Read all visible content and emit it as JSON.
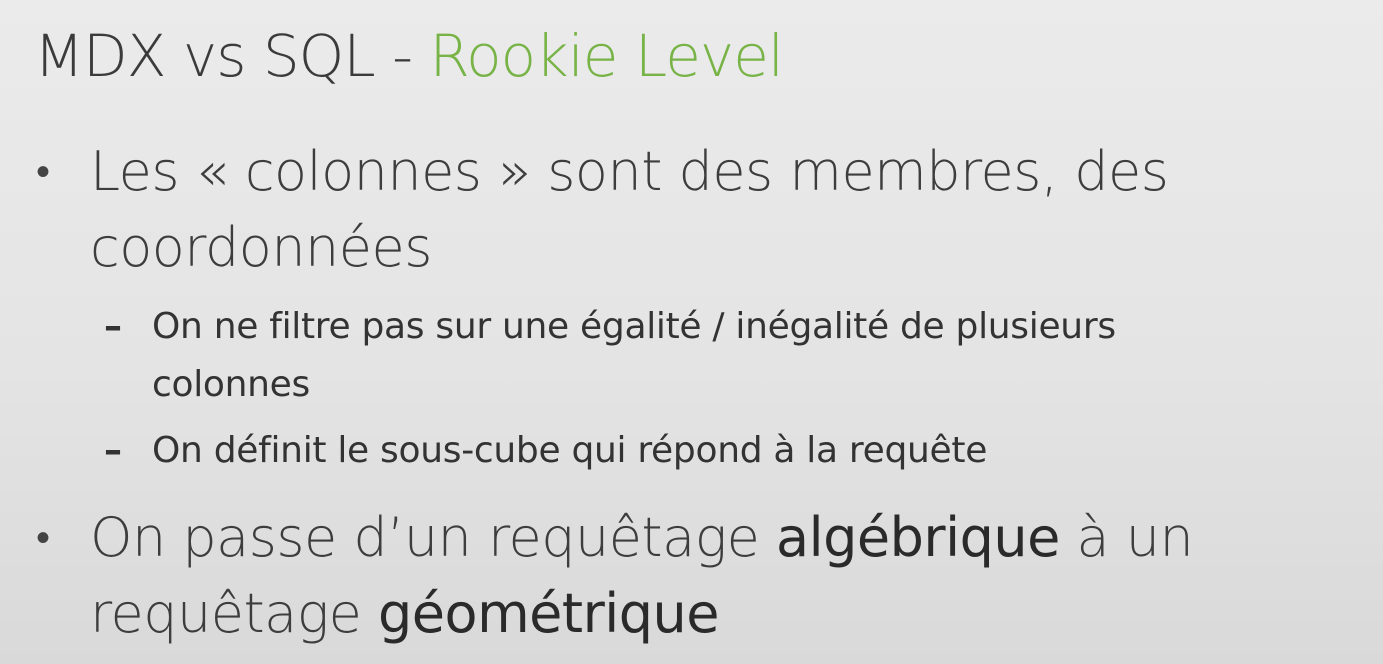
{
  "slide": {
    "title_main": "MDX vs SQL - ",
    "title_accent": "Rookie Level",
    "bullet1": {
      "marker": "•",
      "line1": "Les « colonnes » sont des membres, des",
      "line2": "coordonnées"
    },
    "sub1": {
      "marker": "–",
      "line1": "On ne filtre pas sur une égalité / inégalité de plusieurs",
      "line2": "colonnes"
    },
    "sub2": {
      "marker": "–",
      "line1": "On définit le sous-cube qui répond à la requête"
    },
    "bullet2": {
      "marker": "•",
      "part1": "On passe d’un requêtage ",
      "emph1": "algébrique",
      "part2": " à un",
      "part3": "requêtage ",
      "emph2": "géométrique"
    },
    "colors": {
      "accent": "#77b346",
      "text": "#3a3a3a",
      "background": "#e6e6e6"
    }
  }
}
